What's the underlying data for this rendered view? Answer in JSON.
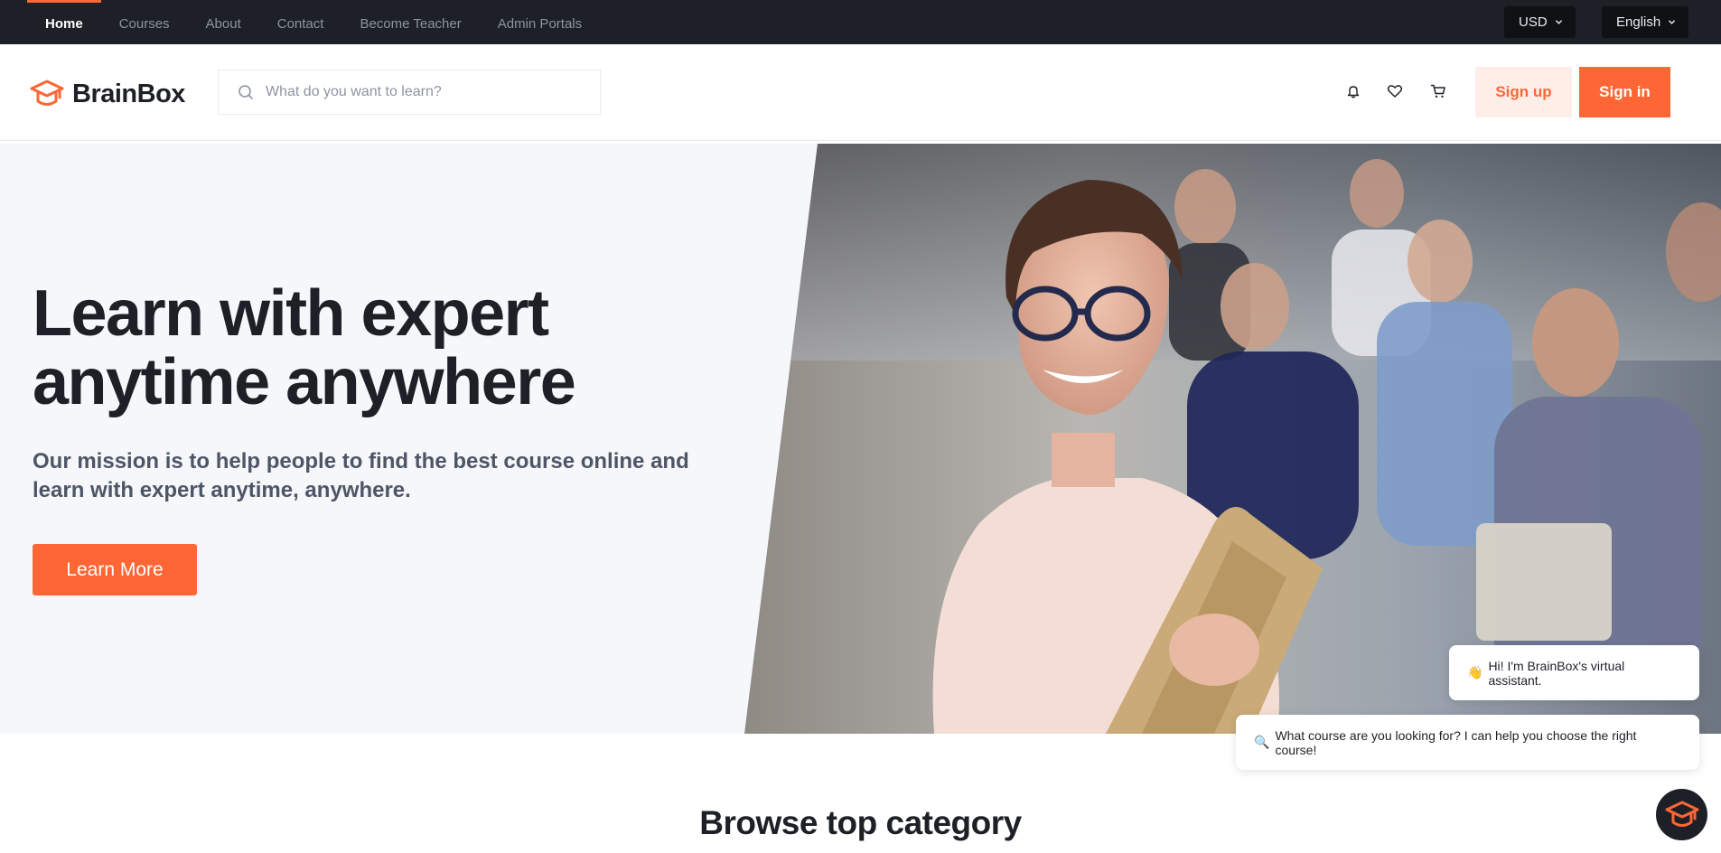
{
  "topnav": {
    "items": [
      {
        "label": "Home",
        "active": true
      },
      {
        "label": "Courses"
      },
      {
        "label": "About"
      },
      {
        "label": "Contact"
      },
      {
        "label": "Become Teacher"
      },
      {
        "label": "Admin Portals"
      }
    ],
    "currency": "USD",
    "language": "English"
  },
  "header": {
    "brand": "BrainBox",
    "search_placeholder": "What do you want to learn?",
    "icons": [
      "bell-icon",
      "heart-icon",
      "cart-icon"
    ],
    "signup_label": "Sign up",
    "signin_label": "Sign in"
  },
  "hero": {
    "title_line1": "Learn with expert",
    "title_line2": "anytime anywhere",
    "subtitle": "Our mission is to help people to find the best course online and learn with expert anytime, anywhere.",
    "cta_label": "Learn More"
  },
  "section": {
    "title": "Browse top category"
  },
  "chat": {
    "message1": "Hi! I'm BrainBox's virtual assistant.",
    "message1_emoji": "👋",
    "message2": "What course are you looking for? I can help you choose the right course!",
    "message2_emoji": "🔍"
  },
  "colors": {
    "brand": "#ff6636",
    "brand_light": "#ffeee8",
    "dark": "#1d2026",
    "hero_bg": "#f5f7fa"
  }
}
